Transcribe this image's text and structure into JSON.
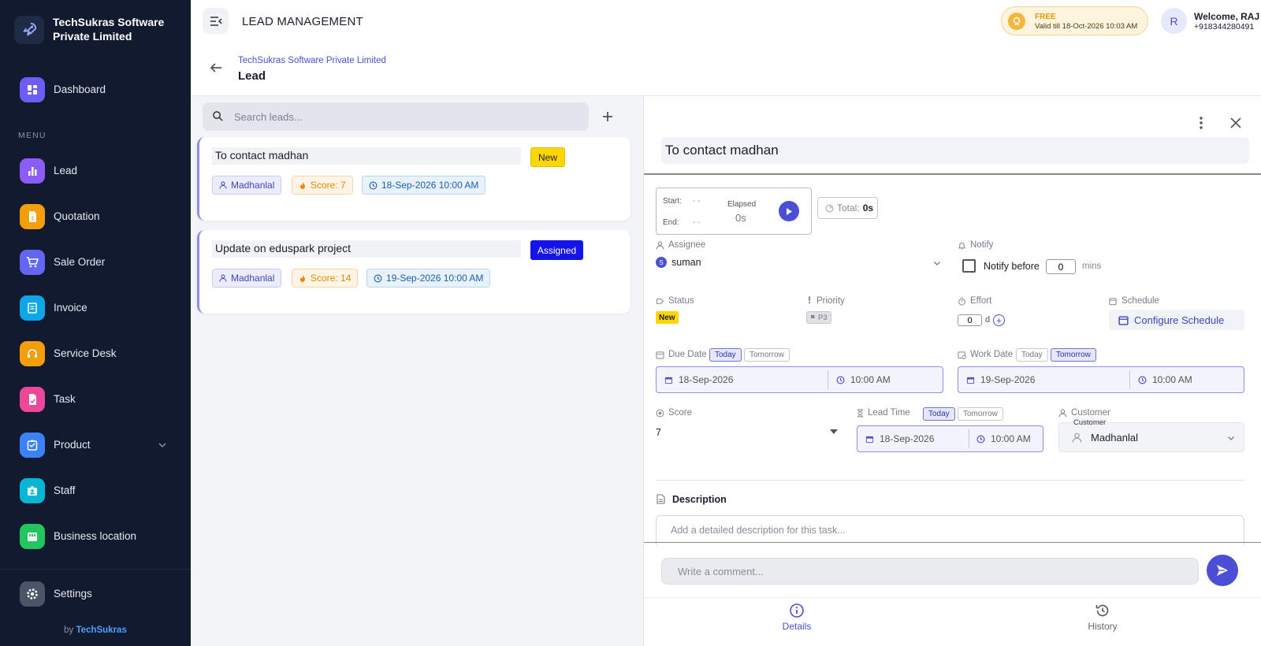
{
  "brand": {
    "name": "TechSukras Software Private Limited"
  },
  "sidebar": {
    "dashboard": "Dashboard",
    "menu_title": "MENU",
    "items": [
      {
        "label": "Lead",
        "color": "#8b5cf6"
      },
      {
        "label": "Quotation",
        "color": "#f59e0b"
      },
      {
        "label": "Sale Order",
        "color": "#6366f1"
      },
      {
        "label": "Invoice",
        "color": "#0ea5e9"
      },
      {
        "label": "Service Desk",
        "color": "#f59e0b"
      },
      {
        "label": "Task",
        "color": "#ec4899"
      },
      {
        "label": "Product",
        "color": "#3b82f6"
      },
      {
        "label": "Staff",
        "color": "#06b6d4"
      },
      {
        "label": "Business location",
        "color": "#22c55e"
      }
    ],
    "settings": "Settings",
    "by_prefix": "by",
    "by_name": "TechSukras"
  },
  "topbar": {
    "title": "LEAD MANAGEMENT",
    "plan": "FREE",
    "plan_valid": "Valid till 18-Oct-2026 10:03 AM",
    "avatar_letter": "R",
    "welcome": "Welcome, RAJ",
    "phone": "+918344280491"
  },
  "breadcrumb": {
    "company": "TechSukras Software Private Limited",
    "title": "Lead"
  },
  "search": {
    "placeholder": "Search leads..."
  },
  "leads": [
    {
      "title": "To contact madhan",
      "status": "New",
      "user": "Madhanlal",
      "score": "Score: 7",
      "date": "18-Sep-2026 10:00 AM"
    },
    {
      "title": "Update on eduspark project",
      "status": "Assigned",
      "user": "Madhanlal",
      "score": "Score: 14",
      "date": "19-Sep-2026 10:00 AM"
    }
  ],
  "detail": {
    "title": "To contact madhan",
    "timer": {
      "start_label": "Start:",
      "start_value": "- -",
      "end_label": "End:",
      "end_value": "- -",
      "elapsed_label": "Elapsed",
      "elapsed_value": "0s",
      "total_label": "Total:",
      "total_value": "0s"
    },
    "assignee": {
      "label": "Assignee",
      "initial": "S",
      "value": "suman"
    },
    "notify": {
      "label": "Notify",
      "text": "Notify before",
      "value": "0",
      "unit": "mins"
    },
    "status": {
      "label": "Status",
      "value": "New"
    },
    "priority": {
      "label": "Priority",
      "value": "P3"
    },
    "effort": {
      "label": "Effort",
      "value": "0",
      "unit": "d",
      "add": "+"
    },
    "schedule": {
      "label": "Schedule",
      "button": "Configure Schedule"
    },
    "due_date": {
      "label": "Due Date",
      "today": "Today",
      "tomorrow": "Tomorrow",
      "date": "18-Sep-2026",
      "time": "10:00 AM"
    },
    "work_date": {
      "label": "Work Date",
      "today": "Today",
      "tomorrow": "Tomorrow",
      "date": "19-Sep-2026",
      "time": "10:00 AM"
    },
    "score": {
      "label": "Score",
      "value": "7"
    },
    "lead_time": {
      "label": "Lead Time",
      "today": "Today",
      "tomorrow": "Tomorrow",
      "date": "18-Sep-2026",
      "time": "10:00 AM"
    },
    "customer": {
      "label": "Customer",
      "float_label": "Customer",
      "value": "Madhanlal"
    },
    "description": {
      "label": "Description",
      "placeholder": "Add a detailed description for this task..."
    },
    "comment": {
      "placeholder": "Write a comment..."
    },
    "tabs": {
      "details": "Details",
      "history": "History"
    }
  }
}
